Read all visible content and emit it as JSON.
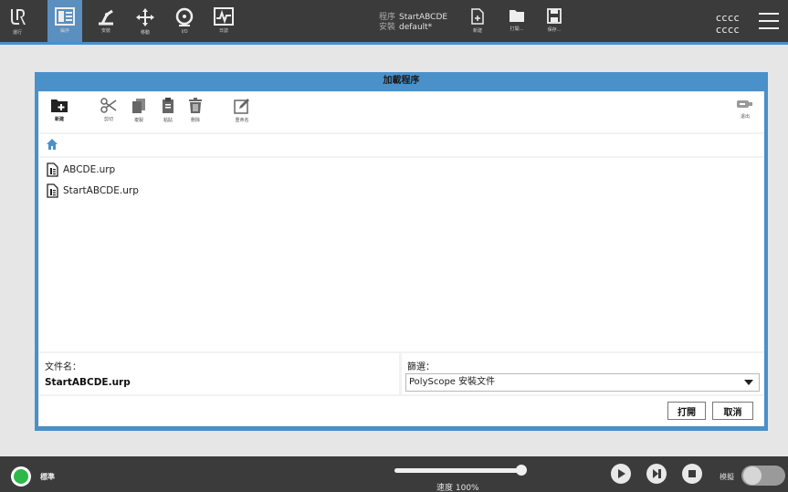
{
  "nav": {
    "logo_label": "運行",
    "items": [
      {
        "label": "編序",
        "icon": "program-icon"
      },
      {
        "label": "安裝",
        "icon": "installation-icon"
      },
      {
        "label": "移動",
        "icon": "move-icon"
      },
      {
        "label": "I/O",
        "icon": "io-icon"
      },
      {
        "label": "日誌",
        "icon": "log-icon"
      }
    ]
  },
  "program_info": {
    "program_key": "程序",
    "program_value": "StartABCDE",
    "install_key": "安裝",
    "install_value": "default*"
  },
  "file_buttons": {
    "new_label": "新建",
    "open_label": "打開...",
    "save_label": "保存..."
  },
  "user": {
    "line1": "cccc",
    "line2": "cccc"
  },
  "dialog": {
    "title": "加載程序",
    "toolbar": {
      "new_folder": "新建",
      "cut": "剪切",
      "copy": "複製",
      "paste": "粘貼",
      "delete": "刪除",
      "rename": "重命名",
      "usb": "退出"
    },
    "files": [
      "ABCDE.urp",
      "StartABCDE.urp"
    ],
    "filename_label": "文件名：",
    "filename_value": "StartABCDE.urp",
    "filter_label": "篩選：",
    "filter_value": "PolyScope 安裝文件",
    "open_button": "打開",
    "cancel_button": "取消"
  },
  "bottom": {
    "mode_label": "標準",
    "speed_label": "速度 100%",
    "speed_value": 100,
    "sim_label": "模擬"
  },
  "colors": {
    "accent": "#4a90c9",
    "bar": "#3b3b3b",
    "status": "#2db84a"
  }
}
